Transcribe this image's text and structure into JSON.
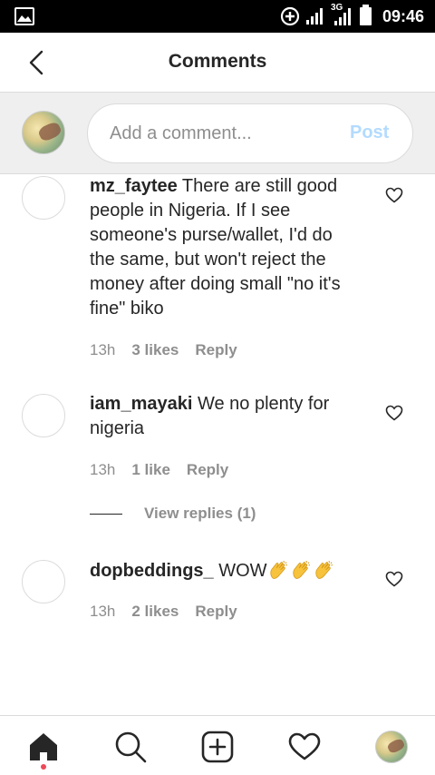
{
  "status_bar": {
    "time": "09:46",
    "network": "3G",
    "icons": [
      "gallery-icon",
      "data-saver-icon",
      "signal-icon",
      "signal-3g-icon",
      "battery-icon"
    ]
  },
  "header": {
    "title": "Comments",
    "back_icon": "chevron-left-icon"
  },
  "composer": {
    "placeholder": "Add a comment...",
    "value": "",
    "post_label": "Post",
    "post_color": "#b3dbff"
  },
  "comments": [
    {
      "username": "mz_faytee",
      "text": "There are still good people in Nigeria. If I see someone's purse/wallet, I'd do the same, but won't reject the money after doing small \"no it's fine\" biko",
      "time": "13h",
      "likes": "3 likes",
      "reply_label": "Reply"
    },
    {
      "username": "iam_mayaki",
      "text": "We no plenty for nigeria",
      "time": "13h",
      "likes": "1 like",
      "reply_label": "Reply",
      "view_replies": "View replies (1)"
    },
    {
      "username": "dopbeddings_",
      "text": "WOW",
      "emoji": "clapping-hands-icon x3",
      "time": "13h",
      "likes": "2 likes",
      "reply_label": "Reply"
    }
  ],
  "bottom_nav": {
    "items": [
      "home-icon",
      "search-icon",
      "add-post-icon",
      "activity-heart-icon",
      "profile-avatar"
    ],
    "active": "home-icon",
    "active_dot_color": "#ed4956"
  }
}
